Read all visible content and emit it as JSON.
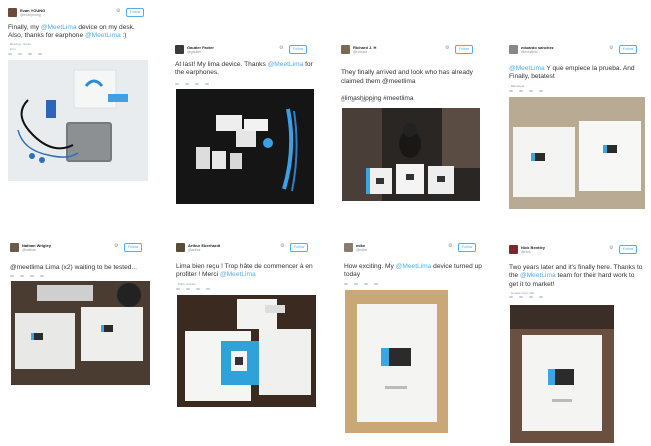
{
  "follow_label": "Follow",
  "gear_glyph": "⚙",
  "tweets": [
    {
      "name": "Evan YOUNG",
      "handle": "@evanyoung",
      "text_parts": [
        {
          "t": "Finally, my "
        },
        {
          "t": "@MeetLima",
          "m": true
        },
        {
          "t": " device on my desk. Also, thanks for earphone "
        },
        {
          "t": "@MeetLima",
          "m": true
        },
        {
          "t": " :)"
        }
      ],
      "meta_lines": [
        "· Meeting · Sonia",
        "· Icon"
      ],
      "photo_desc": "desk"
    },
    {
      "name": "Gautier Favier",
      "handle": "@gautier",
      "text_parts": [
        {
          "t": "At last! My lima device. Thanks "
        },
        {
          "t": "@MeetLima",
          "m": true
        },
        {
          "t": " for the earphones."
        }
      ],
      "meta_lines": [],
      "photo_desc": "unbox"
    },
    {
      "name": "Richard J. H",
      "handle": "@richard",
      "text_parts": [
        {
          "t": "They finally arrived and look who has already claimed them "
        },
        {
          "t": "@meetlima",
          "m": false
        },
        {
          "t": "\n\n#limashipping #meetlima"
        }
      ],
      "meta_lines": [],
      "photo_desc": "cat"
    },
    {
      "name": "eduardo sanchez",
      "handle": "@eduardo",
      "text_parts": [
        {
          "t": "@MeetLima",
          "m": true
        },
        {
          "t": " Y que empiece la prueba. And Finally, betatest"
        }
      ],
      "meta_lines": [
        "· Barcelona"
      ],
      "photo_desc": "boxes2"
    },
    {
      "name": "Nathan Wrigley",
      "handle": "@nathan",
      "text_parts": [
        {
          "t": "@meetlima Lima (x2) waiting to be tested..."
        }
      ],
      "meta_lines": [],
      "photo_desc": "twoboxes"
    },
    {
      "name": "Arthur Eberhardt",
      "handle": "@arthur",
      "text_parts": [
        {
          "t": "Lima bien reçu ! Trop hâte de commencer à en profiter ! Merci "
        },
        {
          "t": "@MeetLima",
          "m": true
        }
      ],
      "meta_lines": [
        "· Paris, France"
      ],
      "photo_desc": "openbox"
    },
    {
      "name": "mike",
      "handle": "@mike",
      "text_parts": [
        {
          "t": "How exciting. My "
        },
        {
          "t": "@MeetLima",
          "m": true
        },
        {
          "t": " device turned up today"
        }
      ],
      "meta_lines": [],
      "photo_desc": "singlebox"
    },
    {
      "name": "Nick Bentley",
      "handle": "@nick",
      "text_parts": [
        {
          "t": "Two years later and it's finally here. Thanks to the "
        },
        {
          "t": "@MeetLima",
          "m": true
        },
        {
          "t": " team for their hard work to get it to market!"
        }
      ],
      "meta_lines": [
        "· Google Lima, MA"
      ],
      "photo_desc": "floorbox"
    }
  ]
}
